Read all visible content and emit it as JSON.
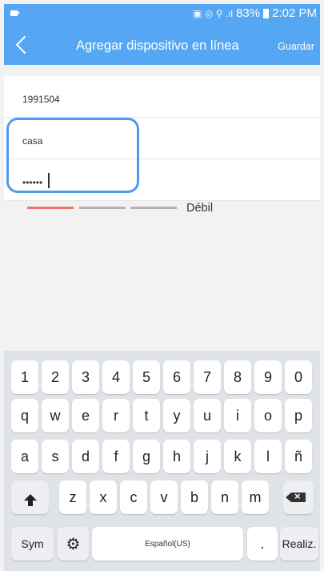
{
  "status_bar": {
    "mini_icons": "▣ ◎ ⚲ .ıl",
    "battery": "83%",
    "time": "2:02 PM"
  },
  "header": {
    "title": "Agregar dispositivo en línea",
    "save_label": "Guardar"
  },
  "form": {
    "device_id": "1991504",
    "name_value": "casa",
    "password_value": "••••••"
  },
  "strength": {
    "label": "Débil",
    "level": "1/3",
    "colors": {
      "active": "#ef7470",
      "inactive": "#b3b3b3"
    }
  },
  "highlight_color": "#4d9bef",
  "keyboard": {
    "row_numbers": [
      "1",
      "2",
      "3",
      "4",
      "5",
      "6",
      "7",
      "8",
      "9",
      "0"
    ],
    "row_top": [
      "q",
      "w",
      "e",
      "r",
      "t",
      "y",
      "u",
      "i",
      "o",
      "p"
    ],
    "row_mid": [
      "a",
      "s",
      "d",
      "f",
      "g",
      "h",
      "j",
      "k",
      "l",
      "ñ"
    ],
    "row_bottom": [
      "z",
      "x",
      "c",
      "v",
      "b",
      "n",
      "m"
    ],
    "sym_label": "Sym",
    "space_label": "Español(US)",
    "period_label": ".",
    "enter_label": "Realiz."
  },
  "icons": [
    "back-chevron-icon",
    "shift-icon",
    "backspace-icon",
    "gear-icon"
  ]
}
